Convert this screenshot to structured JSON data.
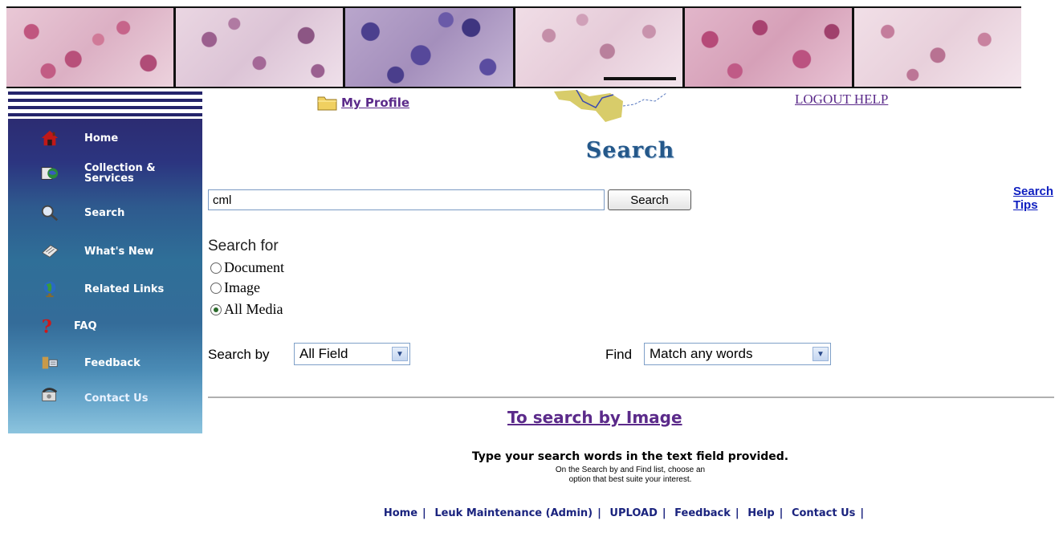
{
  "header": {
    "profile_label": "My Profile",
    "logout_label": "LOGOUT HELP"
  },
  "sidebar": {
    "items": [
      {
        "label": "Home",
        "icon": "house-icon"
      },
      {
        "label": "Collection & Services",
        "icon": "globe-collection-icon"
      },
      {
        "label": "Search",
        "icon": "magnifier-icon"
      },
      {
        "label": "What's New",
        "icon": "newspaper-icon"
      },
      {
        "label": "Related Links",
        "icon": "globe-icon"
      },
      {
        "label": "FAQ",
        "icon": "question-icon"
      },
      {
        "label": "Feedback",
        "icon": "feedback-icon"
      },
      {
        "label": "Contact Us",
        "icon": "phone-icon"
      }
    ]
  },
  "main": {
    "title": "Search",
    "search_value": "cml",
    "search_button": "Search",
    "search_tips": "Search Tips",
    "search_for_label": "Search for",
    "media_options": [
      {
        "label": "Document",
        "checked": false
      },
      {
        "label": "Image",
        "checked": false
      },
      {
        "label": "All Media",
        "checked": true
      }
    ],
    "search_by_label": "Search by",
    "search_by_value": "All Field",
    "find_label": "Find",
    "find_value": "Match any words",
    "image_search_link": "To search by Image",
    "help_main": "Type your search words in the text field provided.",
    "help_sub_1": "On the Search by and Find list, choose an",
    "help_sub_2": "option that best suite your interest."
  },
  "footer": {
    "links": [
      "Home",
      "Leuk Maintenance (Admin)",
      "UPLOAD",
      "Feedback",
      "Help",
      "Contact Us"
    ]
  },
  "colors": {
    "sidebar_dark": "#2c2c72",
    "sidebar_light": "#8cc4de",
    "link_purple": "#5b2a8a",
    "title_blue": "#24588a",
    "footer_navy": "#1a237e"
  }
}
